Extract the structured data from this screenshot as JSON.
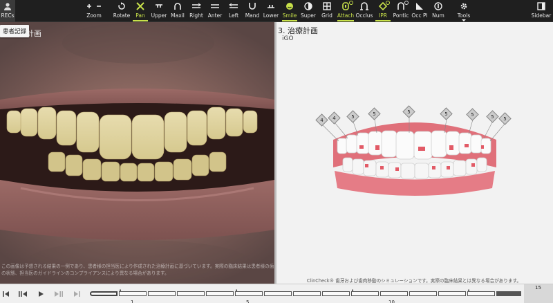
{
  "toolbar": {
    "recs_label": "RECs",
    "recs_tooltip": "患者記録",
    "tools": [
      {
        "id": "zoom",
        "label": "Zoom",
        "icon": "zoom-plus-minus-icon"
      },
      {
        "id": "rotate",
        "label": "Rotate",
        "icon": "rotate-icon"
      },
      {
        "id": "pan",
        "label": "Pan",
        "icon": "pan-icon",
        "active": true
      },
      {
        "id": "upper",
        "label": "Upper",
        "icon": "upper-arch-icon"
      },
      {
        "id": "maxil",
        "label": "Maxil",
        "icon": "maxillary-arch-icon"
      },
      {
        "id": "right",
        "label": "Right",
        "icon": "right-view-icon"
      },
      {
        "id": "anter",
        "label": "Anter",
        "icon": "anterior-view-icon"
      },
      {
        "id": "left",
        "label": "Left",
        "icon": "left-view-icon"
      },
      {
        "id": "mand",
        "label": "Mand",
        "icon": "mandibular-arch-icon"
      },
      {
        "id": "lower",
        "label": "Lower",
        "icon": "lower-arch-icon"
      },
      {
        "id": "smile",
        "label": "Smile",
        "icon": "smile-icon",
        "active": true
      },
      {
        "id": "super",
        "label": "Super",
        "icon": "superimpose-icon"
      },
      {
        "id": "grid",
        "label": "Grid",
        "icon": "grid-icon"
      },
      {
        "id": "attach",
        "label": "Attach",
        "icon": "attachment-icon",
        "active": true
      },
      {
        "id": "occlus",
        "label": "Occlus",
        "icon": "occlusion-icon"
      },
      {
        "id": "ipr",
        "label": "IPR",
        "icon": "ipr-icon",
        "active": true
      },
      {
        "id": "pontic",
        "label": "Pontic",
        "icon": "pontic-icon"
      },
      {
        "id": "occpl",
        "label": "Occ Pl",
        "icon": "occlusal-plane-icon"
      },
      {
        "id": "num",
        "label": "Num",
        "icon": "numbering-icon"
      },
      {
        "id": "tools",
        "label": "Tools",
        "icon": "gear-icon"
      },
      {
        "id": "sidebar",
        "label": "Sidebar",
        "icon": "sidebar-icon"
      }
    ]
  },
  "photo_panel": {
    "title": "計画",
    "disclaimer": "この画像は予想される結果の一例であり、患者様の担当医により作成された治療計画に基づいています。実際の臨床結果は患者様の歯の状態、担当医のガイドラインのコンプライアンスにより異なる場合があります。"
  },
  "viewer_panel": {
    "title": "3. 治療計画",
    "subtitle": "iGO",
    "footer": "ClinCheck® 歯牙および歯肉移動のシミュレーションです。実際の臨床結果とは異なる場合があります。",
    "ipr_tags": [
      "4",
      "4",
      "5",
      "5",
      "5",
      "5",
      "5",
      "5",
      "5"
    ]
  },
  "timeline": {
    "labels": [
      "1",
      "5",
      "10"
    ],
    "final_stage": "15",
    "colors": {
      "accent": "#c8e14a",
      "gum": "#e0707a"
    }
  }
}
